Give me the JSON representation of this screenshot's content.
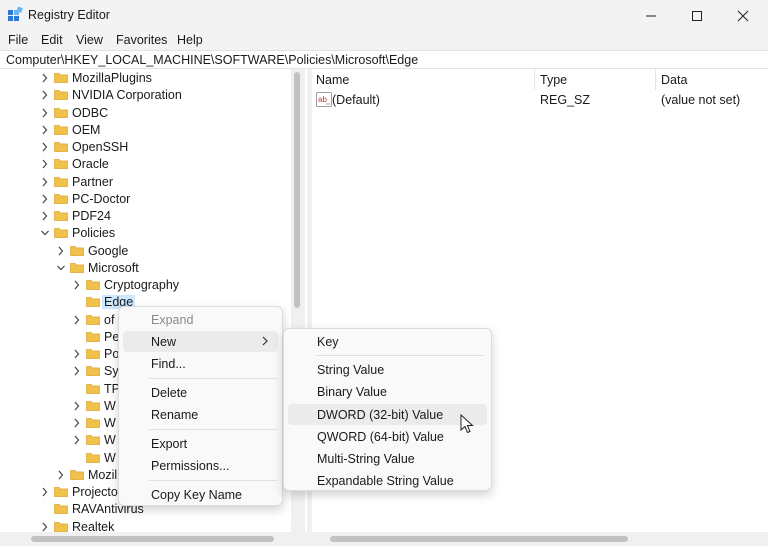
{
  "window": {
    "title": "Registry Editor",
    "app_icon": "regedit-icon",
    "controls": [
      "minimize-icon",
      "maximize-icon",
      "close-icon"
    ]
  },
  "menu": [
    "File",
    "Edit",
    "View",
    "Favorites",
    "Help"
  ],
  "address": "Computer\\HKEY_LOCAL_MACHINE\\SOFTWARE\\Policies\\Microsoft\\Edge",
  "tree": {
    "items": [
      {
        "label": "MozillaPlugins",
        "state": "collapsed"
      },
      {
        "label": "NVIDIA Corporation",
        "state": "collapsed"
      },
      {
        "label": "ODBC",
        "state": "collapsed"
      },
      {
        "label": "OEM",
        "state": "collapsed"
      },
      {
        "label": "OpenSSH",
        "state": "collapsed"
      },
      {
        "label": "Oracle",
        "state": "collapsed"
      },
      {
        "label": "Partner",
        "state": "collapsed"
      },
      {
        "label": "PC-Doctor",
        "state": "collapsed"
      },
      {
        "label": "PDF24",
        "state": "collapsed"
      },
      {
        "label": "Policies",
        "state": "expanded"
      },
      {
        "label": "Google",
        "state": "collapsed"
      },
      {
        "label": "Microsoft",
        "state": "expanded"
      },
      {
        "label": "Cryptography",
        "state": "collapsed"
      },
      {
        "label": "Edge",
        "state": "selected"
      },
      {
        "label": "of",
        "state": "collapsed"
      },
      {
        "label": "Pe",
        "state": "leaf"
      },
      {
        "label": "Po",
        "state": "collapsed"
      },
      {
        "label": "Sy",
        "state": "collapsed"
      },
      {
        "label": "TP",
        "state": "leaf"
      },
      {
        "label": "W",
        "state": "collapsed"
      },
      {
        "label": "W",
        "state": "collapsed"
      },
      {
        "label": "W",
        "state": "collapsed"
      },
      {
        "label": "W",
        "state": "leaf"
      },
      {
        "label": "Mozil",
        "state": "collapsed"
      },
      {
        "label": "Projecto",
        "state": "collapsed"
      },
      {
        "label": "RAVAntivirus",
        "state": "leaf"
      },
      {
        "label": "Realtek",
        "state": "collapsed"
      }
    ]
  },
  "list": {
    "columns": {
      "name": "Name",
      "type": "Type",
      "data": "Data"
    },
    "rows": [
      {
        "name": "(Default)",
        "type": "REG_SZ",
        "data": "(value not set)",
        "icon": "string-value-icon"
      }
    ]
  },
  "context_menu": {
    "expand": "Expand",
    "new": "New",
    "find": "Find...",
    "delete": "Delete",
    "rename": "Rename",
    "export": "Export",
    "permissions": "Permissions...",
    "copy_key_name": "Copy Key Name"
  },
  "new_submenu": {
    "key": "Key",
    "string_value": "String Value",
    "binary_value": "Binary Value",
    "dword_value": "DWORD (32-bit) Value",
    "qword_value": "QWORD (64-bit) Value",
    "multi_string_value": "Multi-String Value",
    "expandable_string_value": "Expandable String Value"
  },
  "colors": {
    "selection": "#cce8ff",
    "folder": "#f0c24b",
    "menu_hover": "#ebebeb"
  }
}
